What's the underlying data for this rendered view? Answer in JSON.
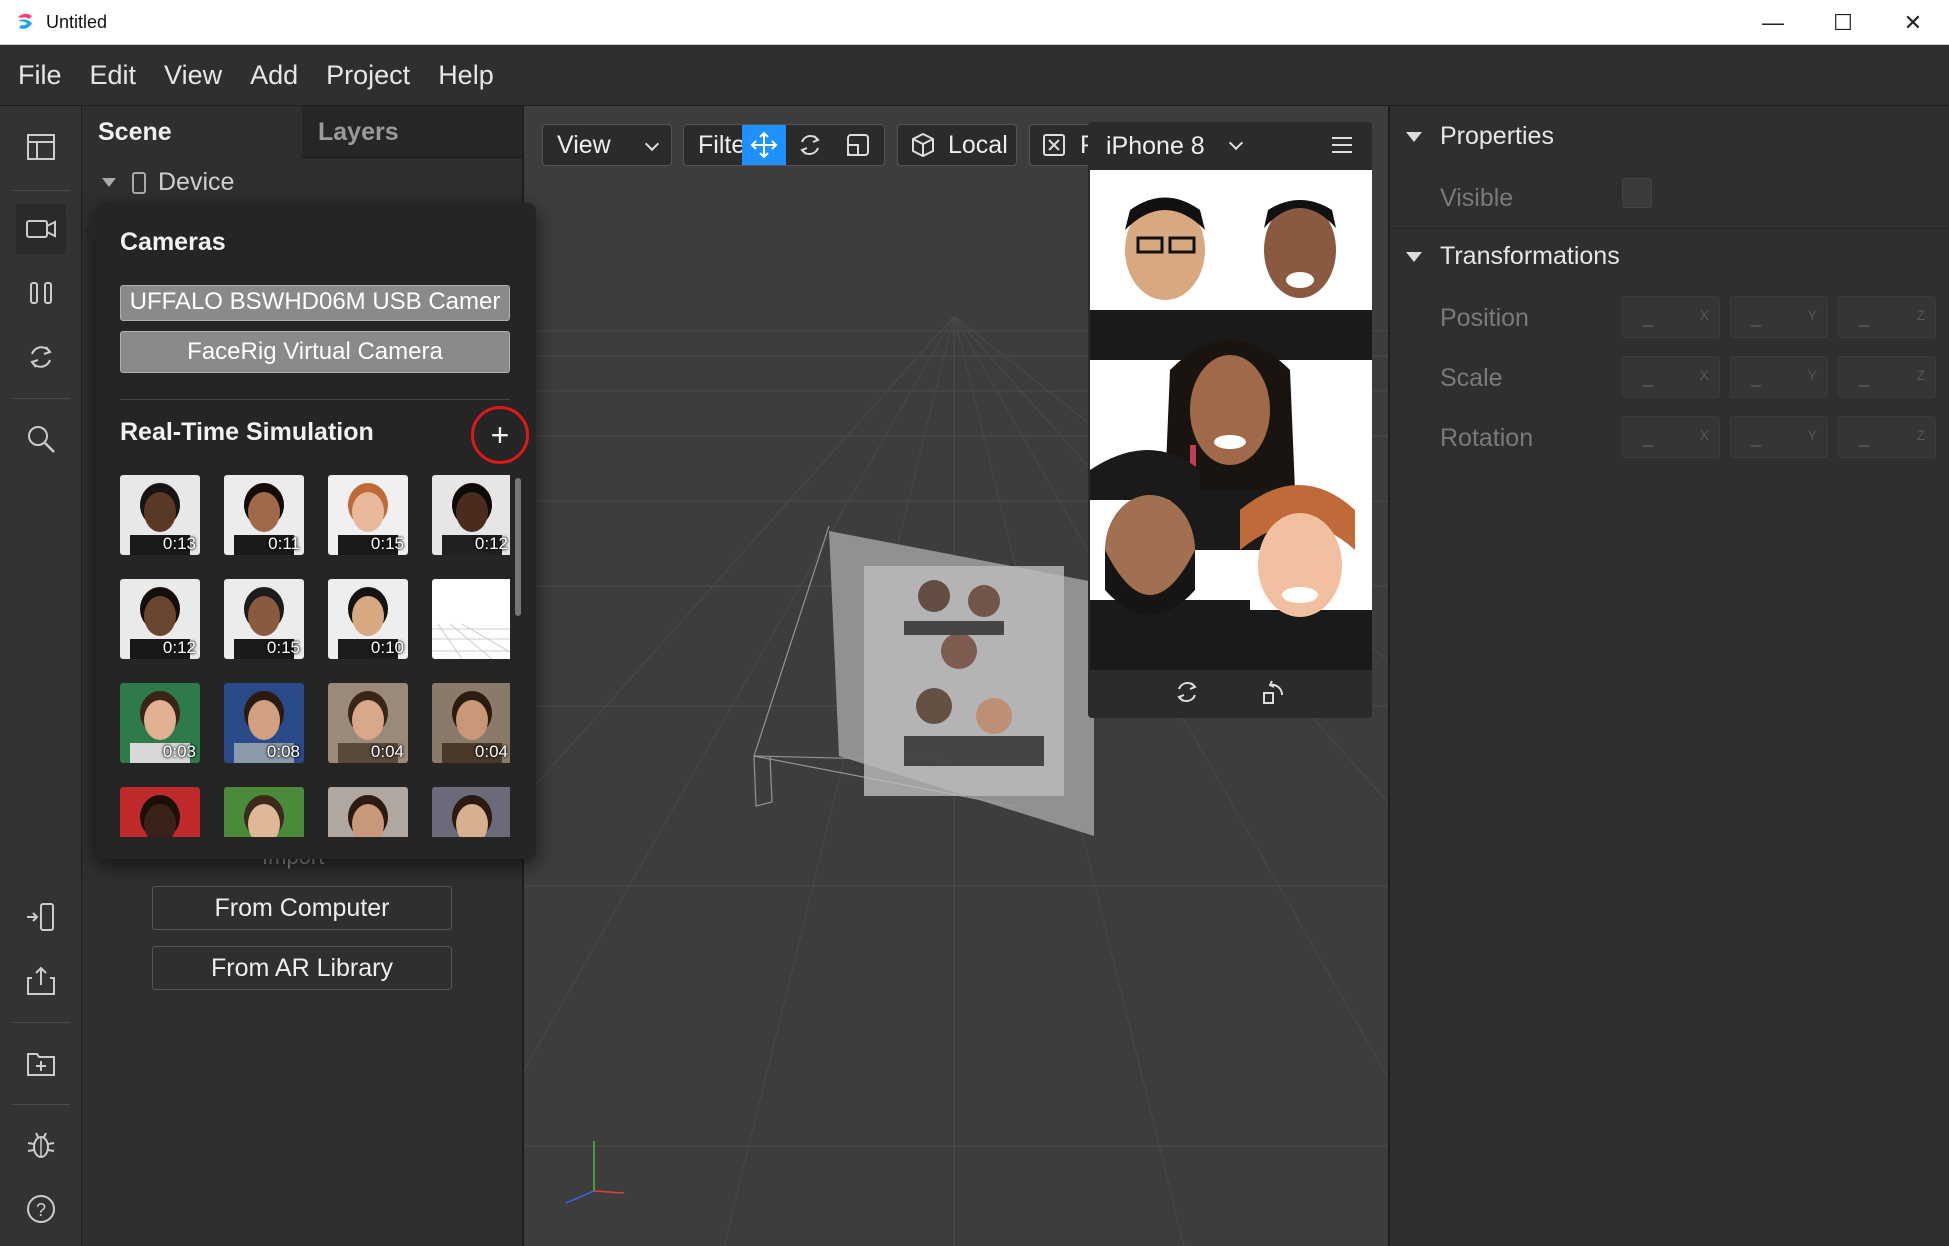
{
  "window": {
    "title": "Untitled",
    "minimize": "—",
    "maximize": "☐",
    "close": "✕"
  },
  "menu": [
    "File",
    "Edit",
    "View",
    "Add",
    "Project",
    "Help"
  ],
  "scene_panel": {
    "tabs": [
      "Scene",
      "Layers"
    ],
    "tree_device": "Device",
    "import_label": "Import",
    "from_computer": "From Computer",
    "from_ar_library": "From AR Library"
  },
  "popover": {
    "cameras_heading": "Cameras",
    "cameras": [
      "UFFALO BSWHD06M USB Camer",
      "FaceRig Virtual Camera"
    ],
    "simulation_heading": "Real-Time Simulation",
    "add_symbol": "+",
    "thumbnails": [
      {
        "duration": "0:13",
        "bg": "#e8e8e8",
        "skin": "#5a3826",
        "hair": "#1a1410",
        "shirt": "#1a1a1a"
      },
      {
        "duration": "0:11",
        "bg": "#ececec",
        "skin": "#a06a4a",
        "hair": "#120c08",
        "shirt": "#1a1a1a"
      },
      {
        "duration": "0:15",
        "bg": "#f0f0f0",
        "skin": "#e8b89a",
        "hair": "#c06a3a",
        "shirt": "#1a1a1a"
      },
      {
        "duration": "0:12",
        "bg": "#e6e6e6",
        "skin": "#4a2c1e",
        "hair": "#0e0a08",
        "shirt": "#202020"
      },
      {
        "duration": "0:12",
        "bg": "#eaeaea",
        "skin": "#6a4530",
        "hair": "#160e0a",
        "shirt": "#181818"
      },
      {
        "duration": "0:15",
        "bg": "#ececec",
        "skin": "#8a5a40",
        "hair": "#1c1c1c",
        "shirt": "#1a1a1a"
      },
      {
        "duration": "0:10",
        "bg": "#eeeeee",
        "skin": "#d8a880",
        "hair": "#141414",
        "shirt": "#1c1c1c"
      },
      {
        "duration": "",
        "bg": "#ffffff",
        "skin": "",
        "hair": "",
        "shirt": ""
      },
      {
        "duration": "0:03",
        "bg": "#2e7a4a",
        "skin": "#e0b090",
        "hair": "#3a2418",
        "shirt": "#d8d8d8"
      },
      {
        "duration": "0:08",
        "bg": "#2a4a8a",
        "skin": "#d0a080",
        "hair": "#2a1a10",
        "shirt": "#8a9aaa"
      },
      {
        "duration": "0:04",
        "bg": "#9a8a7a",
        "skin": "#d8a888",
        "hair": "#3a2418",
        "shirt": "#5a4a3a"
      },
      {
        "duration": "0:04",
        "bg": "#8a7a6a",
        "skin": "#c89878",
        "hair": "#2a1a10",
        "shirt": "#4a3a2a"
      },
      {
        "duration": "",
        "bg": "#c02a2a",
        "skin": "#3a2218",
        "hair": "#1a1008",
        "shirt": "#c02a2a"
      },
      {
        "duration": "",
        "bg": "#4a8a3a",
        "skin": "#e0b898",
        "hair": "#3a2a1a",
        "shirt": "#6a9a4a"
      },
      {
        "duration": "",
        "bg": "#b0a8a0",
        "skin": "#c89878",
        "hair": "#2a1a10",
        "shirt": "#4a4a5a"
      },
      {
        "duration": "",
        "bg": "#6a6a7a",
        "skin": "#d8b090",
        "hair": "#2a1a10",
        "shirt": "#e8e8e8"
      }
    ]
  },
  "viewport": {
    "view_dropdown": "View",
    "filter_label": "Filte",
    "local_label": "Local",
    "partial_label": "P",
    "device_dropdown": "iPhone 8"
  },
  "properties": {
    "properties_heading": "Properties",
    "visible_label": "Visible",
    "transformations_heading": "Transformations",
    "rows": [
      "Position",
      "Scale",
      "Rotation"
    ],
    "placeholder": "_",
    "axes": [
      "X",
      "Y",
      "Z"
    ]
  },
  "colors": {
    "accent": "#1e90ff",
    "highlight_ring": "#e01818",
    "panel_bg": "#2f2f2f",
    "viewport_bg": "#3d3d3d"
  }
}
